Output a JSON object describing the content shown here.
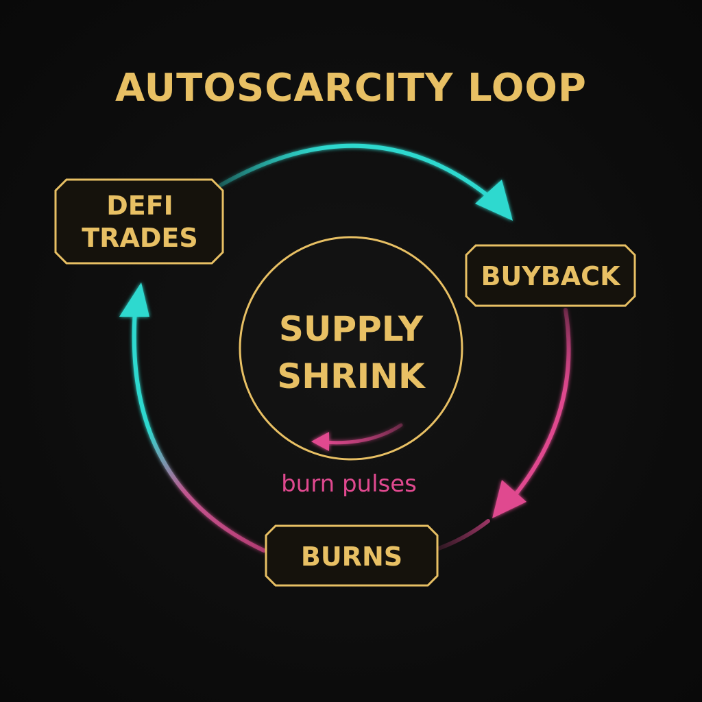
{
  "title": "AUTOSCARCITY LOOP",
  "nodes": {
    "defi": {
      "line1": "DEFI",
      "line2": "TRADES"
    },
    "buyback": {
      "label": "BUYBACK"
    },
    "burns": {
      "label": "BURNS"
    }
  },
  "center": {
    "line1": "SUPPLY",
    "line2": "SHRINK"
  },
  "pulse_label": "burn pulses",
  "colors": {
    "background": "#0d0d0d",
    "gold": "#e8c064",
    "teal": "#2fd9cf",
    "pink": "#e0498f",
    "node_fill": "#15120c"
  },
  "icons": [
    "arrowhead-icon"
  ]
}
